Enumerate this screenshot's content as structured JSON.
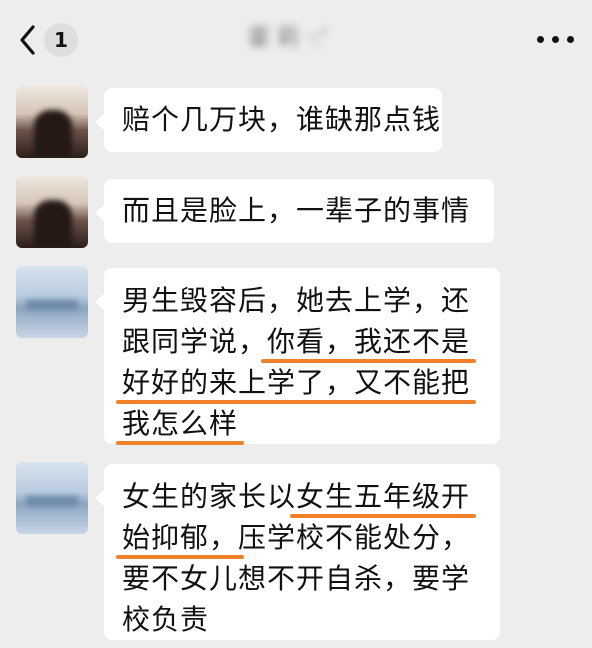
{
  "header": {
    "back_count": "1",
    "title": "霍 莉 ·:‘"
  },
  "messages": [
    {
      "avatar": "dark",
      "lines": [
        [
          "赔个几万块，谁缺那点钱"
        ]
      ]
    },
    {
      "avatar": "dark",
      "lines": [
        [
          "而且是脸上，一辈子的事情"
        ]
      ]
    },
    {
      "avatar": "blue",
      "lines": [
        [
          "男生毁容后，她去上学，还"
        ],
        [
          "跟同学说，",
          "你看，我还不是"
        ],
        [
          "",
          "好好的来上学了，又不能把"
        ],
        [
          "",
          "我怎么样"
        ]
      ]
    },
    {
      "avatar": "blue",
      "lines": [
        [
          "女生的家长以",
          "女生五年级开"
        ],
        [
          "",
          "始抑郁，",
          "压学校不能处分，"
        ],
        [
          "要不女儿想不开自杀，要学"
        ],
        [
          "校负责"
        ]
      ]
    }
  ]
}
